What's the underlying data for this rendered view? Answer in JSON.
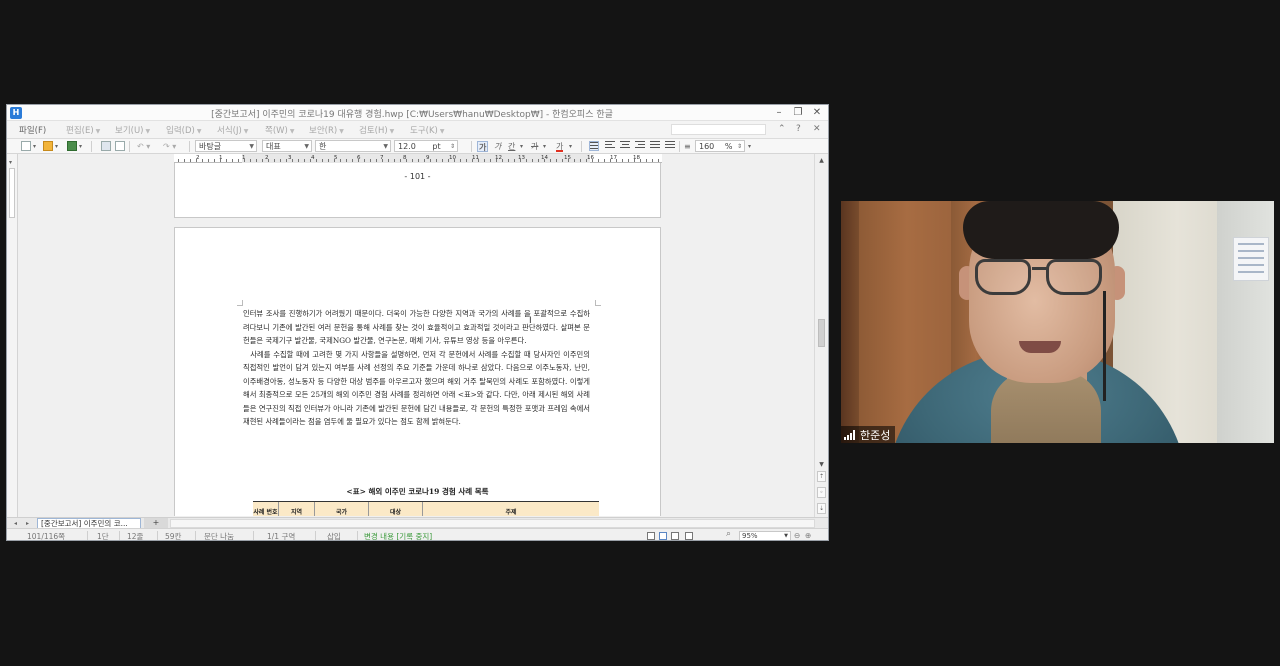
{
  "window": {
    "title": "[중간보고서] 이주민의 코로나19 대유행 경험.hwp [C:₩Users₩hanu₩Desktop₩] - 한컴오피스 한글",
    "app_icon_text": "H"
  },
  "menu": {
    "items": [
      {
        "label": "파일(F)"
      },
      {
        "label": "편집(E)"
      },
      {
        "label": "보기(U)"
      },
      {
        "label": "입력(D)"
      },
      {
        "label": "서식(J)"
      },
      {
        "label": "쪽(W)"
      },
      {
        "label": "보안(R)"
      },
      {
        "label": "검토(H)"
      },
      {
        "label": "도구(K)"
      }
    ]
  },
  "toolbar": {
    "style_name": "바탕글",
    "style_alt": "대표",
    "font_name": "한",
    "font_size": "12.0",
    "font_unit": "pt",
    "bold": "가",
    "italic": "가",
    "underline": "간",
    "strike": "가",
    "font_color": "가",
    "line_spacing": "160",
    "line_spacing_unit": "%"
  },
  "ruler": {
    "numbers": [
      "2",
      "1",
      "1",
      "2",
      "3",
      "4",
      "5",
      "6",
      "7",
      "8",
      "9",
      "10",
      "11",
      "12",
      "13",
      "14",
      "15",
      "16",
      "17",
      "18"
    ]
  },
  "document": {
    "page_number": "- 101 -",
    "paragraphs": [
      "인터뷰 조사를 진행하기가 어려웠기 때문이다. 더욱이 가능한 다양한 지역과 국가의 사례를 을 포괄적으로 수집하려다보니 기존에 발간된 여러 문헌을 통해 사례를 찾는 것이 효율적이고 효과적일 것이라고 판단하였다. 살펴본 문헌들은 국제기구 발간물, 국제NGO 발간물, 연구논문, 매체 기사, 유튜브 영상 등을 아우른다.",
      "사례를 수집할 때에 고려한 몇 가지 사항들을 설명하면, 먼저 각 문헌에서 사례를 수집할 때 당사자인 이주민의 직접적인 발언이 담겨 있는지 여부를 사례 선정의 주요 기준들 가운데 하나로 삼았다. 다음으로 이주노동자, 난민, 이주배경아동, 성노동자 등 다양한 대상 범주를 아우르고자 했으며 해외 거주 탈북민의 사례도 포함하였다. 이렇게 해서 최종적으로 모든 25개의 해외 이주민 경험 사례를 정리하면 아래 <표>와 같다. 다만, 아래 제시된 해외 사례들은 연구진의 직접 인터뷰가 아니라 기존에 발간된 문헌에 담긴 내용들로, 각 문헌의 특정한 포맷과 프레임 속에서 재현된 사례들이라는 점을 염두에 둘 필요가 있다는 점도 함께 밝혀둔다."
    ],
    "table_title": "<표> 해외 이주민 코로나19 경험 사례 목록",
    "table_headers": [
      "사례 번호",
      "지역",
      "국가",
      "대상",
      "주제"
    ]
  },
  "tabs": {
    "active_doc": "[중간보고서] 이주민의 코...",
    "add": "+"
  },
  "status": {
    "page": "101/116쪽",
    "section": "1단",
    "line": "12줄",
    "column": "59칸",
    "break": "문단 나눔",
    "section_count": "1/1 구역",
    "insert_mode": "삽입",
    "track_changes": "변경 내용 [기록 중지]",
    "zoom": "95%"
  },
  "video": {
    "participant_name": "한준성"
  },
  "colors": {
    "table_header_bg": "#fbe9c7",
    "status_green": "#3b9a3b",
    "app_blue": "#2a7bd8"
  }
}
